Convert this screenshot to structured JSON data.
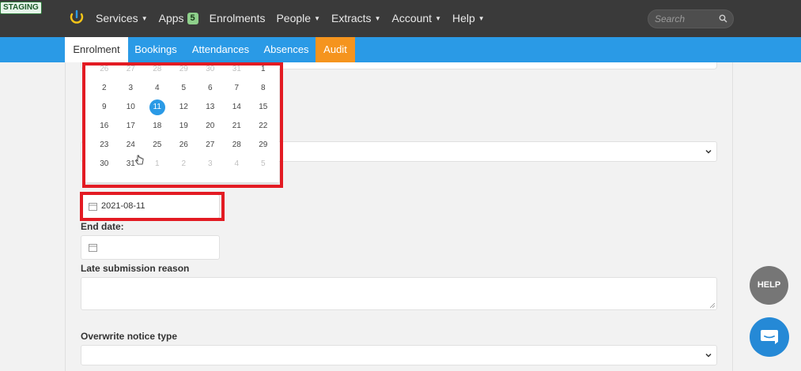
{
  "env_badge": "STAGING",
  "nav": {
    "items": [
      {
        "label": "Services",
        "caret": true
      },
      {
        "label": "Apps",
        "badge": "5",
        "caret": false
      },
      {
        "label": "Enrolments",
        "caret": false
      },
      {
        "label": "People",
        "caret": true
      },
      {
        "label": "Extracts",
        "caret": true
      },
      {
        "label": "Account",
        "caret": true
      },
      {
        "label": "Help",
        "caret": true
      }
    ],
    "search_placeholder": "Search"
  },
  "tabs": [
    {
      "label": "Enrolment",
      "active": true
    },
    {
      "label": "Bookings"
    },
    {
      "label": "Attendances"
    },
    {
      "label": "Absences"
    },
    {
      "label": "Audit",
      "color": "#f5941e"
    }
  ],
  "calendar": {
    "weeks": [
      [
        {
          "d": "26",
          "m": true
        },
        {
          "d": "27",
          "m": true
        },
        {
          "d": "28",
          "m": true
        },
        {
          "d": "29",
          "m": true
        },
        {
          "d": "30",
          "m": true
        },
        {
          "d": "31",
          "m": true
        },
        {
          "d": "1"
        }
      ],
      [
        {
          "d": "2"
        },
        {
          "d": "3"
        },
        {
          "d": "4"
        },
        {
          "d": "5"
        },
        {
          "d": "6"
        },
        {
          "d": "7"
        },
        {
          "d": "8"
        }
      ],
      [
        {
          "d": "9"
        },
        {
          "d": "10"
        },
        {
          "d": "11",
          "sel": true
        },
        {
          "d": "12"
        },
        {
          "d": "13"
        },
        {
          "d": "14"
        },
        {
          "d": "15"
        }
      ],
      [
        {
          "d": "16"
        },
        {
          "d": "17"
        },
        {
          "d": "18"
        },
        {
          "d": "19"
        },
        {
          "d": "20"
        },
        {
          "d": "21"
        },
        {
          "d": "22"
        }
      ],
      [
        {
          "d": "23"
        },
        {
          "d": "24"
        },
        {
          "d": "25"
        },
        {
          "d": "26"
        },
        {
          "d": "27"
        },
        {
          "d": "28"
        },
        {
          "d": "29"
        }
      ],
      [
        {
          "d": "30"
        },
        {
          "d": "31"
        },
        {
          "d": "1",
          "m": true
        },
        {
          "d": "2",
          "m": true
        },
        {
          "d": "3",
          "m": true
        },
        {
          "d": "4",
          "m": true
        },
        {
          "d": "5",
          "m": true
        }
      ]
    ]
  },
  "form": {
    "start_date_value": "2021-08-11",
    "end_date_label": "End date:",
    "end_date_value": "",
    "late_reason_label": "Late submission reason",
    "overwrite_label": "Overwrite notice type"
  },
  "help_label": "HELP",
  "colors": {
    "nav_bg": "#3a3a3a",
    "tab_bg": "#2a9ae6",
    "accent": "#2a9ae6",
    "audit": "#f5941e",
    "highlight": "#e31b23"
  }
}
